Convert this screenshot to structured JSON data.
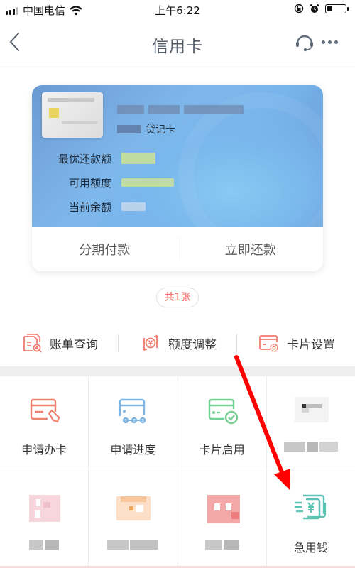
{
  "status_bar": {
    "carrier": "中国电信",
    "time": "上午6:22",
    "battery_level": 0.3
  },
  "nav": {
    "title": "信用卡",
    "back_icon": "chevron-left-icon",
    "service_icon": "headset-icon",
    "more_icon": "more-dots-icon"
  },
  "card": {
    "type_suffix": "贷记卡",
    "rows": [
      {
        "label": "最优还款额",
        "value_color": "#d7e88a"
      },
      {
        "label": "可用额度",
        "value_color": "#d9e68c"
      },
      {
        "label": "当前余额",
        "value_color": "#c6d6ea"
      }
    ],
    "actions": [
      {
        "label": "分期付款"
      },
      {
        "label": "立即还款"
      }
    ]
  },
  "card_count": "共1张",
  "quick_actions": [
    {
      "label": "账单查询",
      "icon": "bill-search-icon"
    },
    {
      "label": "额度调整",
      "icon": "limit-adjust-icon"
    },
    {
      "label": "卡片设置",
      "icon": "card-settings-icon"
    }
  ],
  "services": [
    {
      "label": "申请办卡",
      "icon": "card-apply-icon",
      "color": "#ef8070"
    },
    {
      "label": "申请进度",
      "icon": "apply-progress-icon",
      "color": "#7fb5e2"
    },
    {
      "label": "卡片启用",
      "icon": "card-activate-icon",
      "color": "#78cf95"
    },
    {
      "label": "",
      "icon": "blurred-icon",
      "color": "#9a9a9a"
    },
    {
      "label": "",
      "icon": "blurred-icon",
      "color": "#f2b6c4"
    },
    {
      "label": "",
      "icon": "blurred-icon",
      "color": "#f7c69b"
    },
    {
      "label": "",
      "icon": "blurred-icon",
      "color": "#f08a8a"
    },
    {
      "label": "急用钱",
      "icon": "cash-icon",
      "color": "#5cc3b5"
    }
  ],
  "colors": {
    "accent_red": "#ef6a5e",
    "annotation_arrow": "#ff0000"
  }
}
